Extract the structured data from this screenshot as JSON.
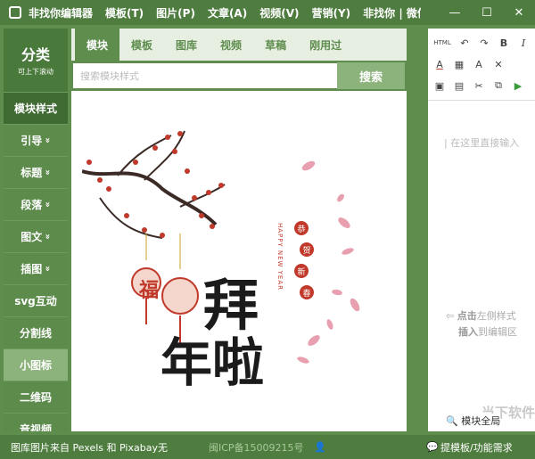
{
  "titlebar": {
    "menu": [
      "非找你编辑器",
      "模板(T)",
      "图片(P)",
      "文章(A)",
      "视频(V)",
      "营销(Y)",
      "非找你 | 微信编..."
    ],
    "minimize": "—",
    "maximize": "☐",
    "close": "✕"
  },
  "sidebar": {
    "title": "分类",
    "subtitle": "可上下滚动",
    "items": [
      {
        "label": "模块样式",
        "chevron": ""
      },
      {
        "label": "引导",
        "chevron": "»"
      },
      {
        "label": "标题",
        "chevron": "»"
      },
      {
        "label": "段落",
        "chevron": "»"
      },
      {
        "label": "图文",
        "chevron": "»"
      },
      {
        "label": "插图",
        "chevron": "»"
      },
      {
        "label": "svg互动",
        "chevron": ""
      },
      {
        "label": "分割线",
        "chevron": ""
      },
      {
        "label": "小图标",
        "chevron": ""
      },
      {
        "label": "二维码",
        "chevron": ""
      },
      {
        "label": "音视频",
        "chevron": ""
      }
    ]
  },
  "tabs": [
    "模块",
    "模板",
    "图库",
    "视频",
    "草稿",
    "刚用过"
  ],
  "search": {
    "placeholder": "搜索模块样式",
    "button": "搜索"
  },
  "poster": {
    "line1": "拜",
    "line2": "年啦",
    "vertical": "HAPPY NEW YEAR",
    "seals": [
      "恭",
      "贺",
      "新",
      "春"
    ],
    "lantern_char": "福"
  },
  "editor": {
    "toolbar_row1": [
      "HTML",
      "↶",
      "↷",
      "B",
      "I"
    ],
    "toolbar_row2": [
      "A",
      "▦",
      "A",
      "✕"
    ],
    "toolbar_row3": [
      "▣",
      "▤",
      "✂",
      "⧉",
      "▶"
    ],
    "placeholder": "在这里直接输入",
    "tip_bold": "点击",
    "tip_line1": "左侧样式",
    "tip_line2_bold": "插入",
    "tip_line2": "到编辑区",
    "watermark": "当下软件园",
    "search_button": "模块全局"
  },
  "status": {
    "left": "图库图片来自 Pexels 和 Pixabay无",
    "center": "闽ICP备15009215号",
    "right": "提模板/功能需求"
  },
  "colors": {
    "primary": "#5f8d4e",
    "dark": "#4f7d40",
    "light": "#8db37c",
    "accent_red": "#c0392b"
  }
}
